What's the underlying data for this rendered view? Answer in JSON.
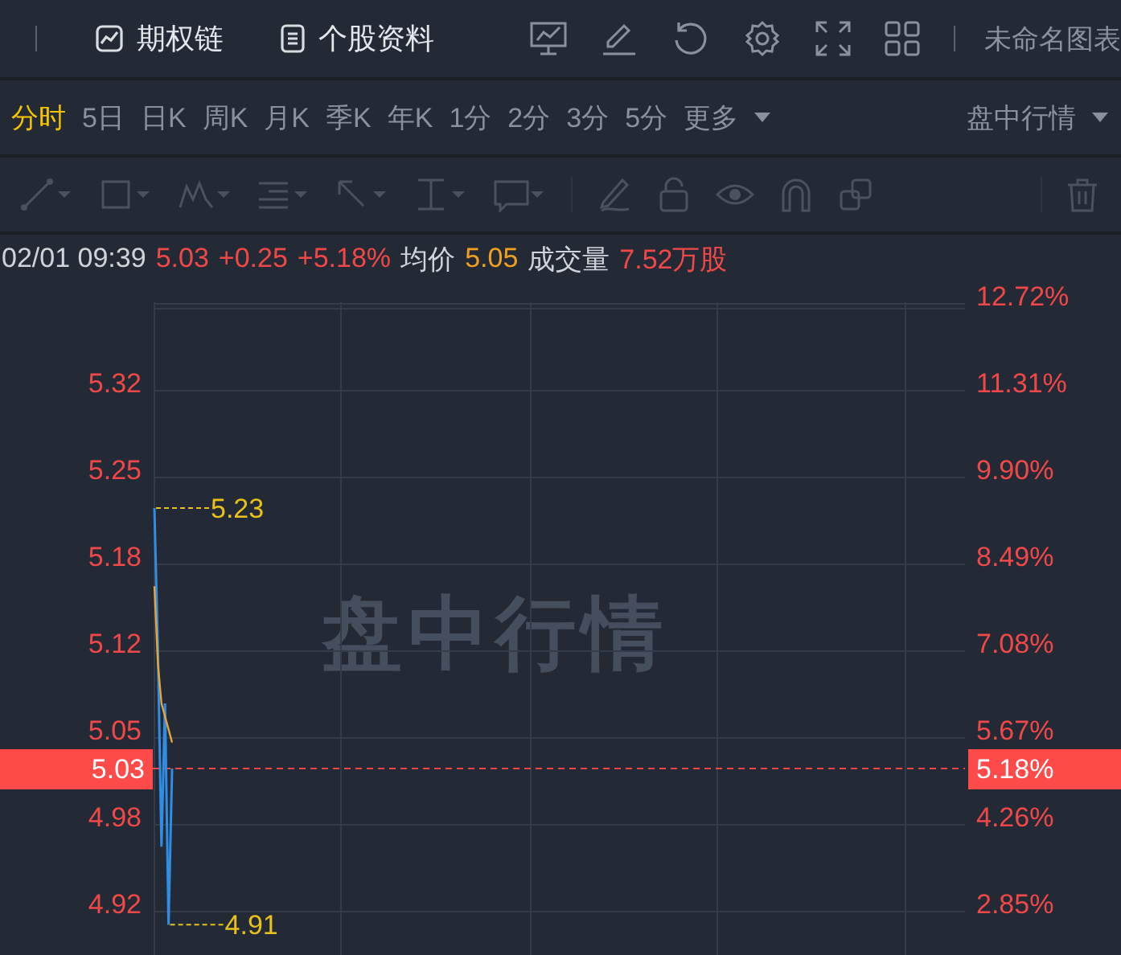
{
  "toolbar": {
    "links": [
      {
        "label": "期权链"
      },
      {
        "label": "个股资料"
      }
    ],
    "chart_name": "未命名图表"
  },
  "periods": [
    {
      "label": "分时",
      "selected": true
    },
    {
      "label": "5日",
      "selected": false
    },
    {
      "label": "日K",
      "selected": false
    },
    {
      "label": "周K",
      "selected": false
    },
    {
      "label": "月K",
      "selected": false
    },
    {
      "label": "季K",
      "selected": false
    },
    {
      "label": "年K",
      "selected": false
    },
    {
      "label": "1分",
      "selected": false
    },
    {
      "label": "2分",
      "selected": false
    },
    {
      "label": "3分",
      "selected": false
    },
    {
      "label": "5分",
      "selected": false
    }
  ],
  "more_menu": {
    "label": "更多"
  },
  "view_menu": {
    "label": "盘中行情"
  },
  "quote": {
    "time": "02/01 09:39",
    "price": "5.03",
    "change": "+0.25",
    "change_pct": "+5.18%",
    "avg_label": "均价",
    "avg_value": "5.05",
    "volume_label": "成交量",
    "volume_value": "7.52万股"
  },
  "chart": {
    "watermark": "盘中行情",
    "right_labels": [
      "12.72%",
      "11.31%",
      "9.90%",
      "8.49%",
      "7.08%",
      "5.67%",
      "4.26%",
      "2.85%"
    ],
    "current_price": "5.03",
    "current_pct": "5.18%",
    "high_label": "5.23",
    "low_label": "4.91",
    "left_labels": [
      "5.32",
      "5.25",
      "5.18",
      "5.12",
      "5.05",
      "4.98",
      "4.92"
    ]
  }
}
